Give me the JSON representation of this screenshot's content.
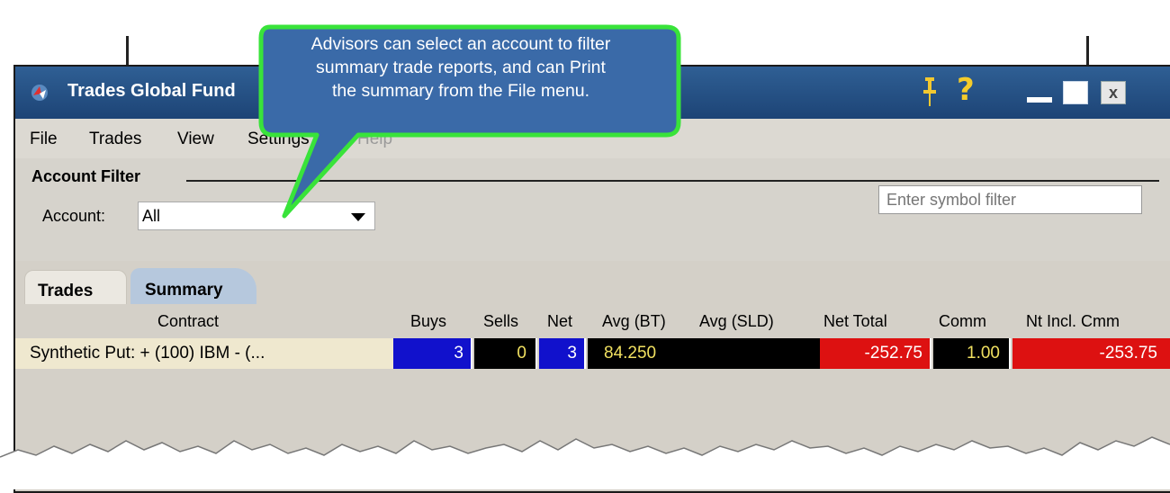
{
  "window": {
    "title": "Trades Global Fund"
  },
  "menu": {
    "file": "File",
    "trades": "Trades",
    "view": "View",
    "settings": "Settings",
    "help": "Help"
  },
  "account_filter": {
    "title": "Account Filter",
    "account_label": "Account:",
    "account_value": "All"
  },
  "symbol_filter": {
    "placeholder": "Enter symbol filter"
  },
  "tabs": [
    {
      "label": "Trades",
      "active": false
    },
    {
      "label": "Summary",
      "active": true
    }
  ],
  "table": {
    "headers": {
      "contract": "Contract",
      "buys": "Buys",
      "sells": "Sells",
      "net": "Net",
      "avg_bt": "Avg (BT)",
      "avg_sld": "Avg (SLD)",
      "net_total": "Net Total",
      "comm": "Comm",
      "nt_incl_cmm": "Nt Incl. Cmm"
    },
    "rows": [
      {
        "contract": "Synthetic Put:  + (100) IBM - (...",
        "buys": "3",
        "sells": "0",
        "net": "3",
        "avg_bt": "84.250",
        "avg_sld": "",
        "net_total": "-252.75",
        "comm": "1.00",
        "nt_incl_cmm": "-253.75"
      }
    ]
  },
  "callout": {
    "line1": "Advisors can select an account to filter",
    "line2": "summary trade reports, and can Print",
    "line3": "the summary from the File menu."
  },
  "colors": {
    "titlebar": "#1d4476",
    "callout_fill": "#3a6aa8",
    "callout_border": "#39e33a",
    "buy_cell": "#1111cc",
    "loss_cell": "#dd1111"
  },
  "icons": [
    "app-icon",
    "pin-icon",
    "help-icon",
    "minimize-icon",
    "maximize-icon",
    "close-icon",
    "dropdown-arrow-icon"
  ]
}
